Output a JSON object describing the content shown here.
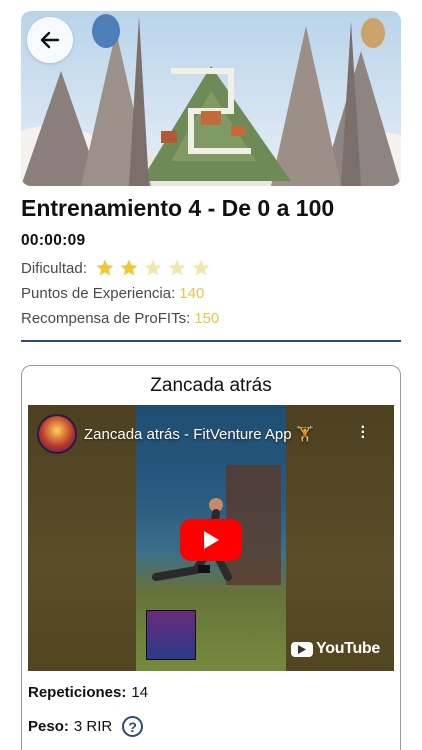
{
  "workout": {
    "title": "Entrenamiento 4 - De 0 a 100",
    "timer": "00:00:09",
    "difficulty_label": "Dificultad:",
    "difficulty_rating": 2,
    "difficulty_max": 5,
    "xp_label": "Puntos de Experiencia:",
    "xp_value": "140",
    "reward_label": "Recompensa de ProFITs:",
    "reward_value": "150"
  },
  "exercise": {
    "name": "Zancada atrás",
    "video": {
      "title": "Zancada atrás - FitVenture App 🏋",
      "brand": "YouTube"
    },
    "reps_label": "Repeticiones:",
    "reps_value": "14",
    "weight_label": "Peso:",
    "weight_value": "3 RIR",
    "help_symbol": "?"
  },
  "colors": {
    "accent_gold": "#e9c44a",
    "divider_navy": "#2c4a6b",
    "star_empty": "#f3e7b0",
    "star_filled": "#f2c734",
    "play_red": "#ff0000"
  },
  "icons": {
    "back": "arrow-left-icon",
    "star": "star-icon",
    "play": "play-icon",
    "help": "question-circle-icon",
    "menu": "more-vertical-icon",
    "youtube": "youtube-icon"
  }
}
